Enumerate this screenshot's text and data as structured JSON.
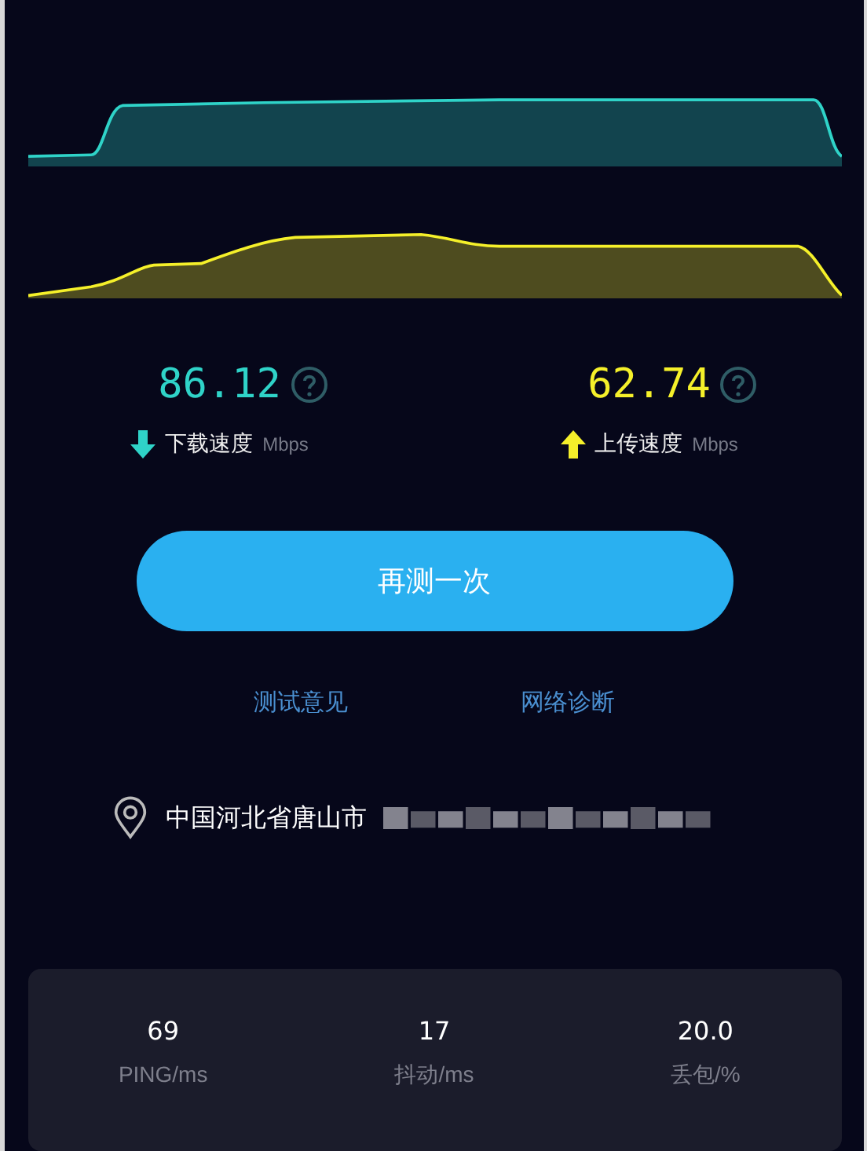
{
  "speeds": [
    {
      "kind": "download",
      "value": "86.12",
      "label": "下载速度",
      "unit": "Mbps",
      "color": "#2fd3c8"
    },
    {
      "kind": "upload",
      "value": "62.74",
      "label": "上传速度",
      "unit": "Mbps",
      "color": "#f5f02a"
    }
  ],
  "retest_button": "再测一次",
  "links": [
    "测试意见",
    "网络诊断"
  ],
  "location": "中国河北省唐山市",
  "stats": [
    {
      "value": "69",
      "label": "PING/ms"
    },
    {
      "value": "17",
      "label": "抖动/ms"
    },
    {
      "value": "20.0",
      "label": "丢包/%"
    }
  ]
}
